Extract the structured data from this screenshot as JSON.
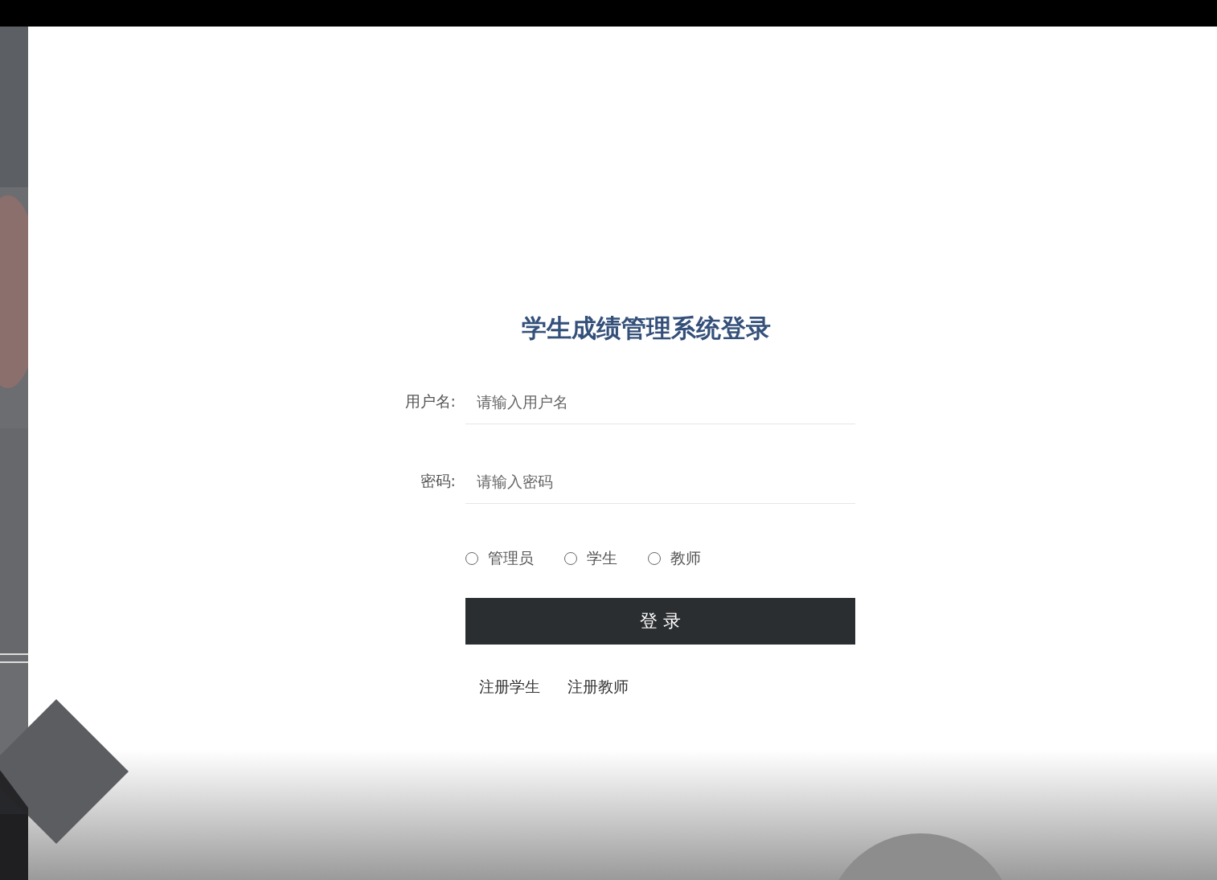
{
  "title": "学生成绩管理系统登录",
  "fields": [
    {
      "label": "用户名:",
      "placeholder": "请输入用户名"
    },
    {
      "label": "密码:",
      "placeholder": "请输入密码"
    }
  ],
  "roles": [
    {
      "label": "管理员",
      "selected": false
    },
    {
      "label": "学生",
      "selected": false
    },
    {
      "label": "教师",
      "selected": false
    }
  ],
  "login_button": "登 录",
  "links": [
    "注册学生",
    "注册教师"
  ]
}
